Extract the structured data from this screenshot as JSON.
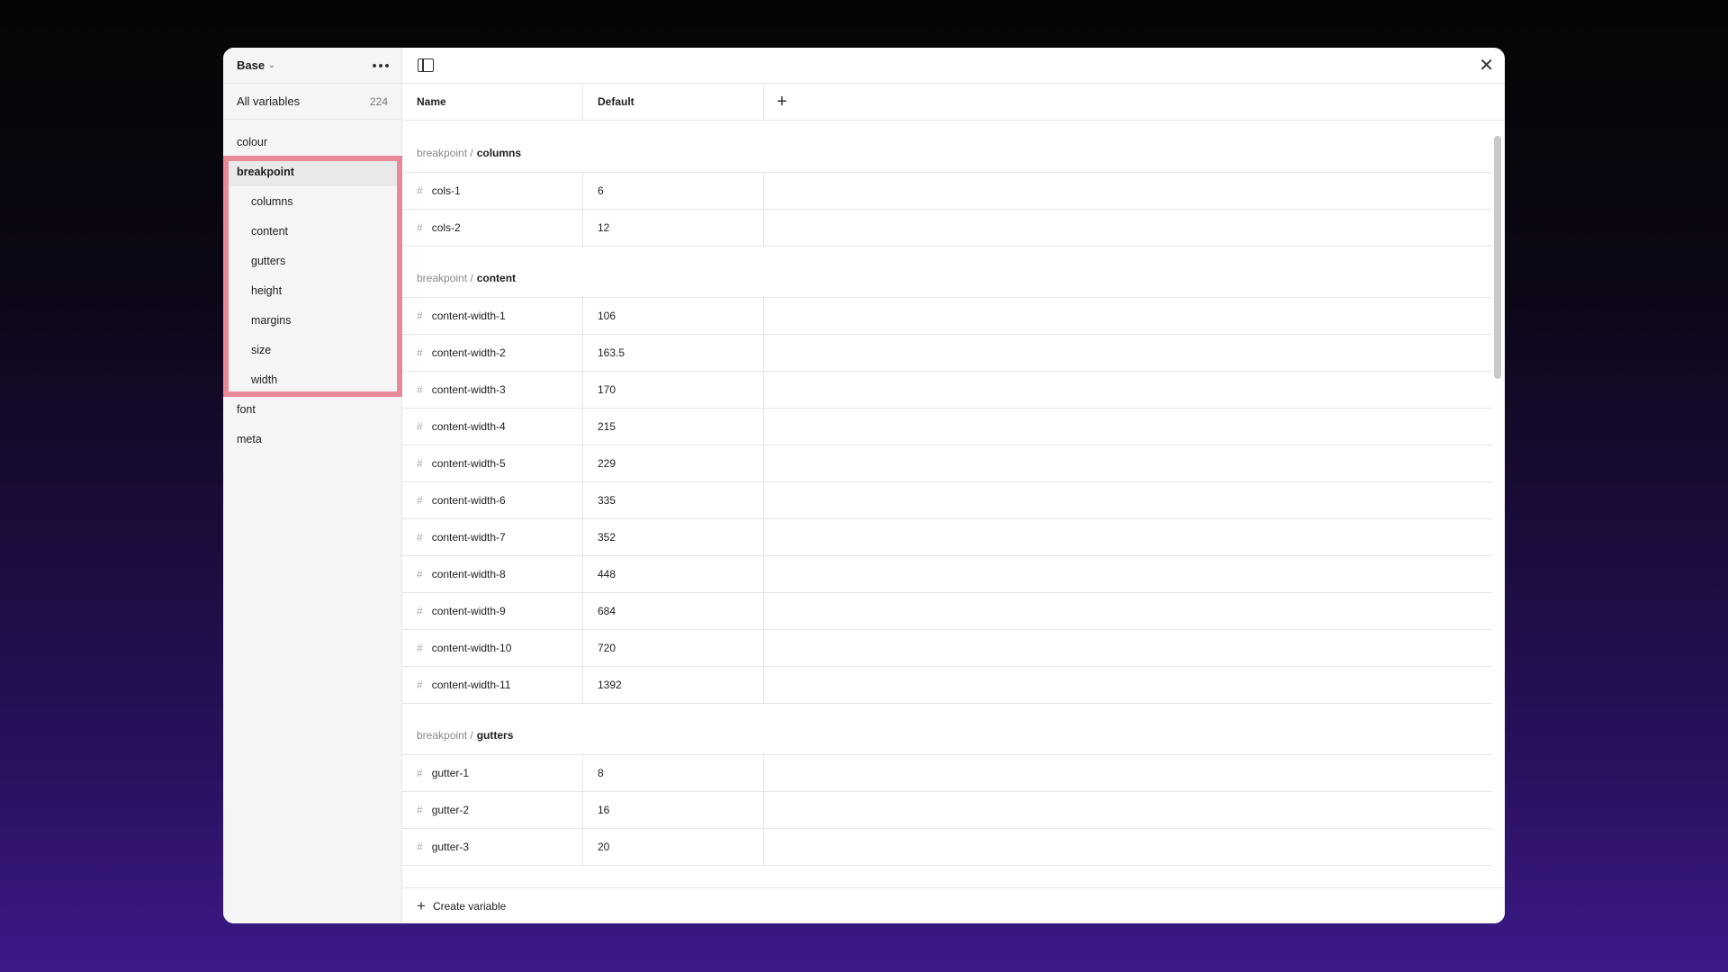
{
  "sidebar": {
    "collection": "Base",
    "all_label": "All variables",
    "all_count": "224",
    "items": [
      {
        "label": "colour",
        "level": 0
      },
      {
        "label": "breakpoint",
        "level": 0,
        "active": true
      },
      {
        "label": "columns",
        "level": 1
      },
      {
        "label": "content",
        "level": 1
      },
      {
        "label": "gutters",
        "level": 1
      },
      {
        "label": "height",
        "level": 1
      },
      {
        "label": "margins",
        "level": 1
      },
      {
        "label": "size",
        "level": 1
      },
      {
        "label": "width",
        "level": 1
      },
      {
        "label": "font",
        "level": 0
      },
      {
        "label": "meta",
        "level": 0
      }
    ]
  },
  "table": {
    "col_name": "Name",
    "col_default": "Default",
    "groups": [
      {
        "prefix": "breakpoint /",
        "name": "columns",
        "rows": [
          {
            "name": "cols-1",
            "value": "6"
          },
          {
            "name": "cols-2",
            "value": "12"
          }
        ]
      },
      {
        "prefix": "breakpoint /",
        "name": "content",
        "rows": [
          {
            "name": "content-width-1",
            "value": "106"
          },
          {
            "name": "content-width-2",
            "value": "163.5"
          },
          {
            "name": "content-width-3",
            "value": "170"
          },
          {
            "name": "content-width-4",
            "value": "215"
          },
          {
            "name": "content-width-5",
            "value": "229"
          },
          {
            "name": "content-width-6",
            "value": "335"
          },
          {
            "name": "content-width-7",
            "value": "352"
          },
          {
            "name": "content-width-8",
            "value": "448"
          },
          {
            "name": "content-width-9",
            "value": "684"
          },
          {
            "name": "content-width-10",
            "value": "720"
          },
          {
            "name": "content-width-11",
            "value": "1392"
          }
        ]
      },
      {
        "prefix": "breakpoint /",
        "name": "gutters",
        "rows": [
          {
            "name": "gutter-1",
            "value": "8"
          },
          {
            "name": "gutter-2",
            "value": "16"
          },
          {
            "name": "gutter-3",
            "value": "20"
          }
        ]
      }
    ]
  },
  "footer": {
    "create_label": "Create variable"
  },
  "icons": {
    "variable_type": "number-hash-icon",
    "add_column": "plus-icon",
    "close": "close-icon",
    "panel": "sidebar-toggle-icon",
    "more": "more-dots-icon"
  },
  "colors": {
    "highlight": "#e8899a",
    "background_bottom": "#3b1a88"
  }
}
